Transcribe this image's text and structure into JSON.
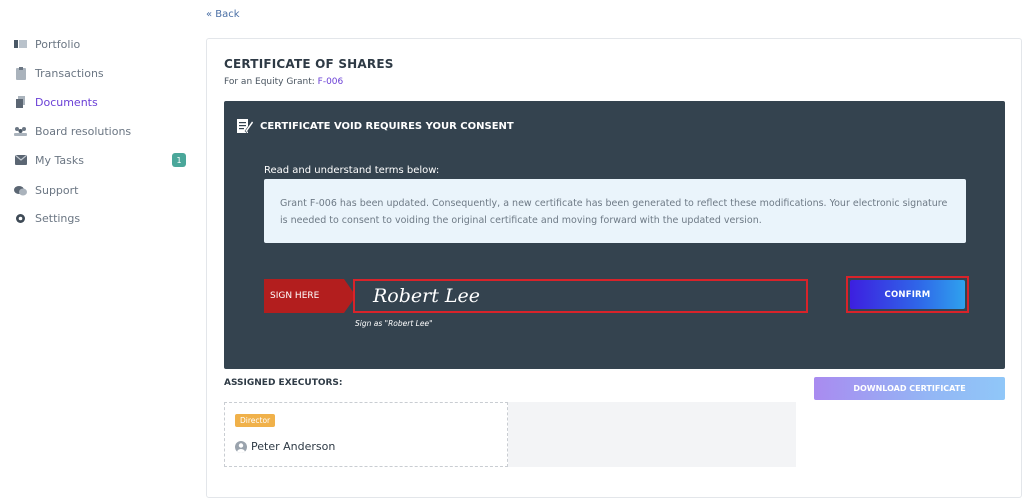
{
  "sidebar": {
    "items": [
      {
        "label": "Portfolio",
        "icon": "portfolio-icon"
      },
      {
        "label": "Transactions",
        "icon": "transactions-icon"
      },
      {
        "label": "Documents",
        "icon": "documents-icon"
      },
      {
        "label": "Board resolutions",
        "icon": "board-icon"
      },
      {
        "label": "My Tasks",
        "icon": "tasks-icon",
        "badge": "1"
      },
      {
        "label": "Support",
        "icon": "support-icon"
      },
      {
        "label": "Settings",
        "icon": "settings-icon"
      }
    ],
    "active_index": 2
  },
  "back_label": "« Back",
  "certificate": {
    "title": "CERTIFICATE OF SHARES",
    "subtitle_prefix": "For an Equity Grant: ",
    "grant_id": "F-006"
  },
  "consent": {
    "heading": "CERTIFICATE VOID REQUIRES YOUR CONSENT",
    "read_label": "Read and understand terms below:",
    "terms": "Grant F-006 has been updated. Consequently, a new certificate has been generated to reflect these modifications. Your electronic signature is needed to consent to voiding the original certificate and moving forward with the updated version.",
    "sign_here_label": "SIGN HERE",
    "signature_value": "Robert Lee",
    "sign_hint": "Sign as \"Robert Lee\"",
    "confirm_label": "CONFIRM"
  },
  "executors": {
    "label": "ASSIGNED EXECUTORS:",
    "download_label": "DOWNLOAD CERTIFICATE",
    "list": [
      {
        "role": "Director",
        "name": "Peter Anderson"
      }
    ]
  },
  "colors": {
    "accent": "#6a3fd6",
    "panel": "#34434f",
    "danger": "#d8232a",
    "badge": "#4aa79a",
    "role_tag": "#f0b14a"
  }
}
